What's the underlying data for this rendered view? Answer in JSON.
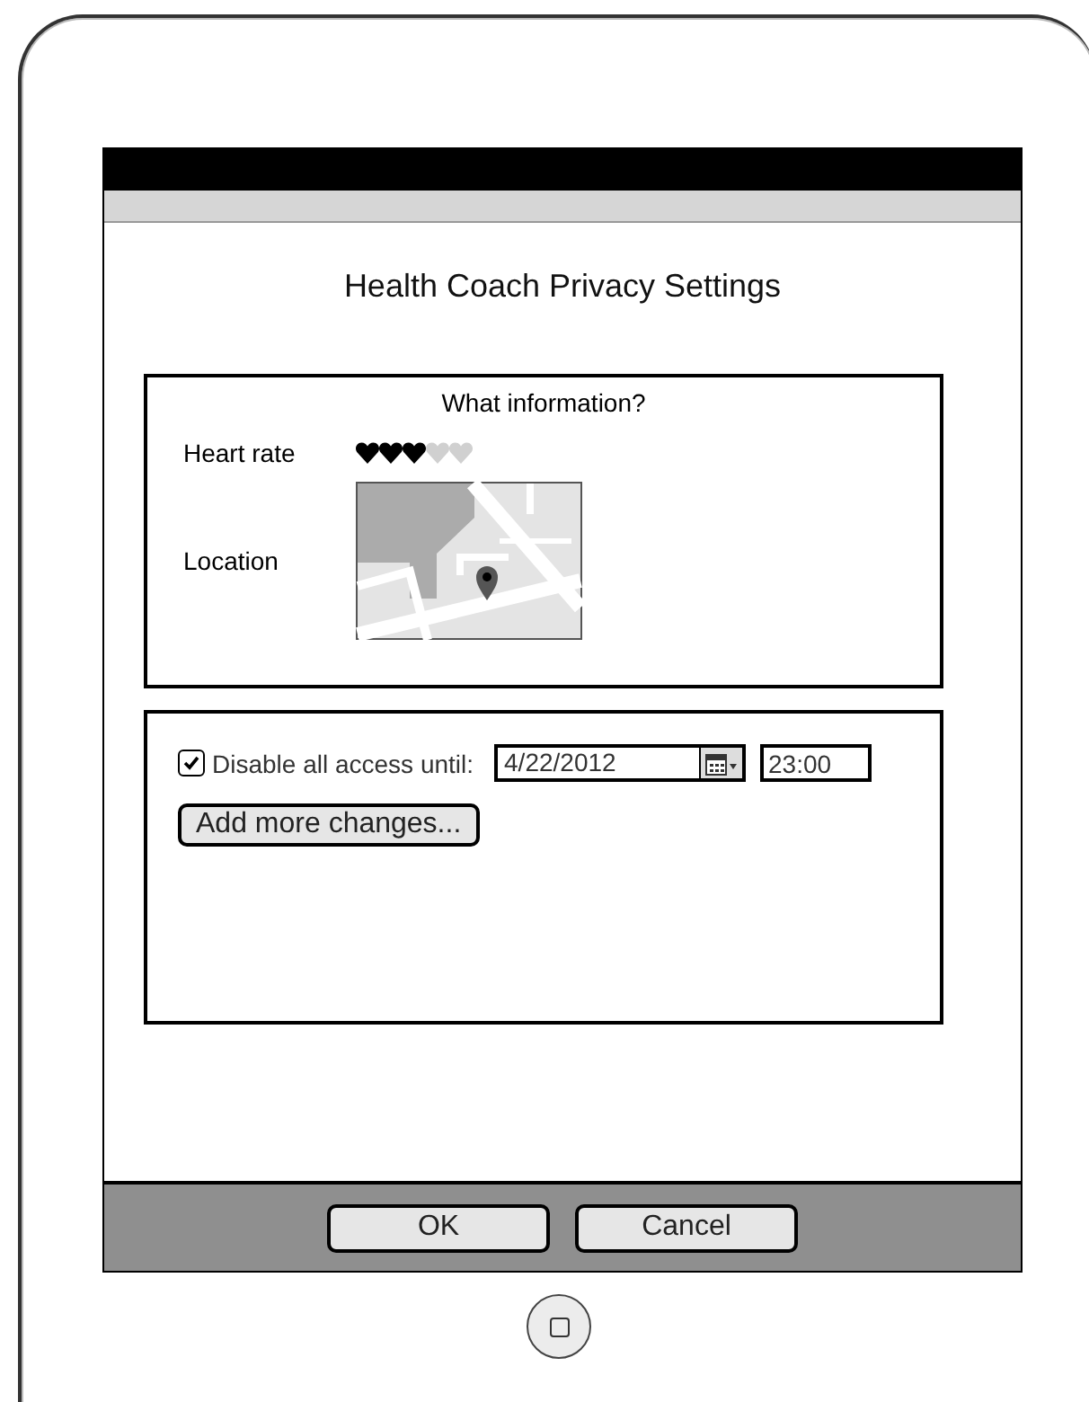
{
  "title": "Health Coach Privacy Settings",
  "info_panel": {
    "heading": "What information?",
    "heart_rate": {
      "label": "Heart rate",
      "stars": 3
    },
    "location": {
      "label": "Location"
    }
  },
  "access_panel": {
    "checkbox": {
      "label": "Disable all access until:",
      "checked": true
    },
    "date_field": {
      "value": "4/22/2012"
    },
    "time_field": {
      "value": "23:00"
    },
    "add_button": "Add more changes..."
  },
  "buttons": [
    "OK",
    "Cancel"
  ]
}
